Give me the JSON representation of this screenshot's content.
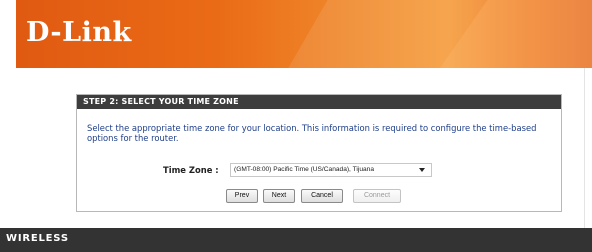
{
  "header": {
    "logo_text": "D-Link"
  },
  "panel": {
    "title": "STEP 2: SELECT YOUR TIME ZONE",
    "description": "Select the appropriate time zone for your location. This information is required to configure the time-based options for the router.",
    "timezone_label": "Time Zone :",
    "timezone_value": "(GMT-08:00) Pacific Time (US/Canada), Tijuana"
  },
  "buttons": {
    "prev": "Prev",
    "next": "Next",
    "cancel": "Cancel",
    "connect": "Connect"
  },
  "footer": {
    "brand": "WIRELESS"
  },
  "colors": {
    "header_orange": "#e96a16",
    "panel_title_bg": "#3d3d3d",
    "description_text": "#1f3f8a",
    "footer_bg": "#333333"
  }
}
